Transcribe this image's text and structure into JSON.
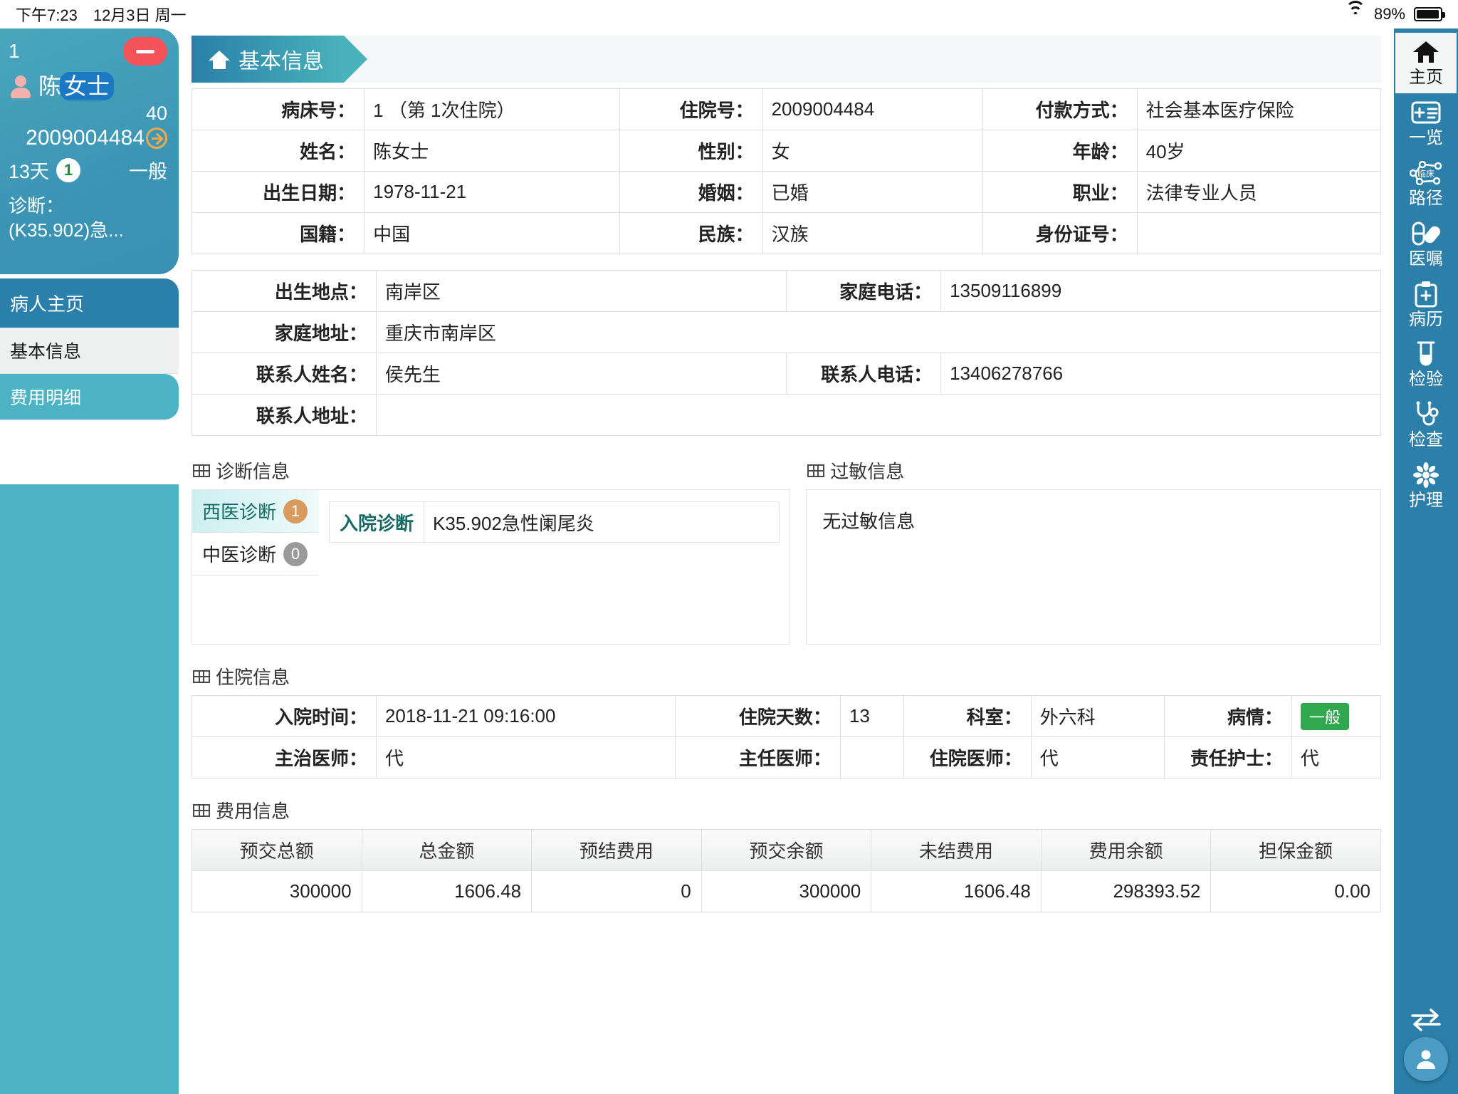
{
  "statusbar": {
    "time": "下午7:23",
    "date": "12月3日 周一",
    "battery": "89%",
    "wifi_icon": "wifi-icon",
    "battery_icon": "battery-icon"
  },
  "patient_card": {
    "bed_no": "1",
    "name_prefix": "陈",
    "name_highlight": "女士",
    "age": "40",
    "inpatient_no": "2009004484",
    "days": "13天",
    "badge_count": "1",
    "condition": "一般",
    "diagnosis_label": "诊断：",
    "diagnosis_value": "(K35.902)急...",
    "minus_icon": "minus-icon",
    "avatar_icon": "avatar-icon",
    "arrow_icon": "arrow-right-circle-icon"
  },
  "sidebar": {
    "header": "病人主页",
    "items": [
      {
        "label": "基本信息",
        "active": false
      },
      {
        "label": "费用明细",
        "active": true
      }
    ]
  },
  "tab": {
    "label": "基本信息",
    "home_icon": "home-icon"
  },
  "basic_info": {
    "rows": [
      [
        {
          "label": "病床号：",
          "value": "1          （第 1次住院）"
        },
        {
          "label": "住院号：",
          "value": "2009004484"
        },
        {
          "label": "付款方式：",
          "value": "社会基本医疗保险"
        }
      ],
      [
        {
          "label": "姓名：",
          "value": "陈女士"
        },
        {
          "label": "性别：",
          "value": "女"
        },
        {
          "label": "年龄：",
          "value": "40岁"
        }
      ],
      [
        {
          "label": "出生日期：",
          "value": "1978-11-21"
        },
        {
          "label": "婚姻：",
          "value": "已婚"
        },
        {
          "label": "职业：",
          "value": "法律专业人员"
        }
      ],
      [
        {
          "label": "国籍：",
          "value": "中国"
        },
        {
          "label": "民族：",
          "value": "汉族"
        },
        {
          "label": "身份证号：",
          "value": ""
        }
      ]
    ]
  },
  "contact_info": {
    "rows": [
      [
        {
          "label": "出生地点：",
          "value": "南岸区"
        },
        {
          "label": "家庭电话：",
          "value": "13509116899"
        }
      ],
      [
        {
          "label": "家庭地址：",
          "value": "重庆市南岸区"
        }
      ],
      [
        {
          "label": "联系人姓名：",
          "value": "侯先生"
        },
        {
          "label": "联系人电话：",
          "value": "13406278766"
        }
      ],
      [
        {
          "label": "联系人地址：",
          "value": ""
        }
      ]
    ]
  },
  "diagnosis_section": {
    "title": "诊断信息",
    "tabs": [
      {
        "label": "西医诊断",
        "count": "1",
        "active": true
      },
      {
        "label": "中医诊断",
        "count": "0",
        "active": false
      }
    ],
    "entry_label": "入院诊断",
    "entry_value": "K35.902急性阑尾炎"
  },
  "allergy_section": {
    "title": "过敏信息",
    "content": "无过敏信息"
  },
  "stay_section": {
    "title": "住院信息",
    "rows": [
      [
        {
          "label": "入院时间：",
          "value": "2018-11-21 09:16:00"
        },
        {
          "label": "住院天数：",
          "value": "13"
        },
        {
          "label": "科室：",
          "value": "外六科"
        },
        {
          "label": "病情：",
          "value": "一般",
          "badge": true
        }
      ],
      [
        {
          "label": "主治医师：",
          "value": "代"
        },
        {
          "label": "主任医师：",
          "value": ""
        },
        {
          "label": "住院医师：",
          "value": "代"
        },
        {
          "label": "责任护士：",
          "value": "代"
        }
      ]
    ]
  },
  "fee_section": {
    "title": "费用信息",
    "headers": [
      "预交总额",
      "总金额",
      "预结费用",
      "预交余额",
      "未结费用",
      "费用余额",
      "担保金额"
    ],
    "values": [
      "300000",
      "1606.48",
      "0",
      "300000",
      "1606.48",
      "298393.52",
      "0.00"
    ]
  },
  "rail": {
    "items": [
      {
        "label": "主页",
        "icon": "home-icon",
        "active": true
      },
      {
        "label": "一览",
        "icon": "overview-card-icon",
        "active": false
      },
      {
        "label": "路径",
        "icon": "clinical-pathway-icon",
        "active": false
      },
      {
        "label": "医嘱",
        "icon": "capsule-pill-icon",
        "active": false
      },
      {
        "label": "病历",
        "icon": "clipboard-icon",
        "active": false
      },
      {
        "label": "检验",
        "icon": "test-tube-icon",
        "active": false
      },
      {
        "label": "检查",
        "icon": "stethoscope-icon",
        "active": false
      },
      {
        "label": "护理",
        "icon": "flower-care-icon",
        "active": false
      }
    ],
    "bottom": [
      {
        "icon": "swap-arrows-icon"
      },
      {
        "icon": "power-icon"
      }
    ],
    "fab_icon": "user-icon"
  },
  "colors": {
    "rail_bg": "#2c7fa8",
    "card_teal": "#3c95b5",
    "accent_teal": "#4cb3c4",
    "label_green": "#186a64",
    "red": "#f4535a",
    "orange": "#d99a5e",
    "green_badge": "#2fa84f"
  }
}
